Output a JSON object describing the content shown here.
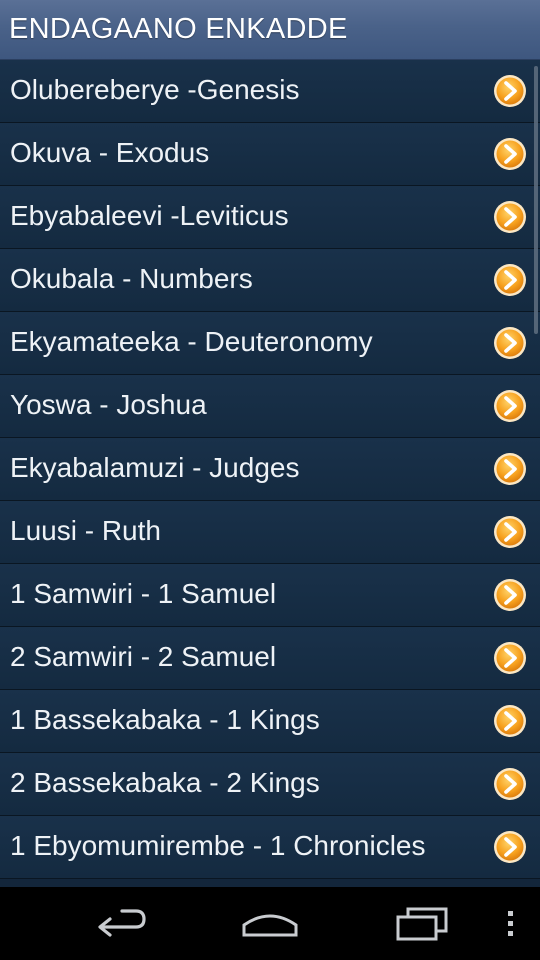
{
  "app": {
    "title": "ENDAGAANO ENKADDE"
  },
  "books": [
    {
      "label": "Olubereberye -Genesis"
    },
    {
      "label": "Okuva - Exodus"
    },
    {
      "label": "Ebyabaleevi -Leviticus"
    },
    {
      "label": "Okubala - Numbers"
    },
    {
      "label": "Ekyamateeka - Deuteronomy"
    },
    {
      "label": "Yoswa - Joshua"
    },
    {
      "label": "Ekyabalamuzi - Judges"
    },
    {
      "label": "Luusi - Ruth"
    },
    {
      "label": "1 Samwiri - 1 Samuel"
    },
    {
      "label": "2 Samwiri - 2 Samuel"
    },
    {
      "label": "1 Bassekabaka - 1 Kings"
    },
    {
      "label": "2 Bassekabaka - 2 Kings"
    },
    {
      "label": "1 Ebyomumirembe - 1 Chronicles"
    }
  ],
  "icons": {
    "item_arrow": "chevron-right-circle-icon",
    "nav_back": "back-icon",
    "nav_home": "home-icon",
    "nav_recents": "recent-apps-icon",
    "nav_menu": "overflow-menu-icon"
  },
  "colors": {
    "titlebar": "#4a6289",
    "list_bg": "#142a40",
    "arrow_orange": "#f7a11e",
    "text": "#eef2f6"
  }
}
